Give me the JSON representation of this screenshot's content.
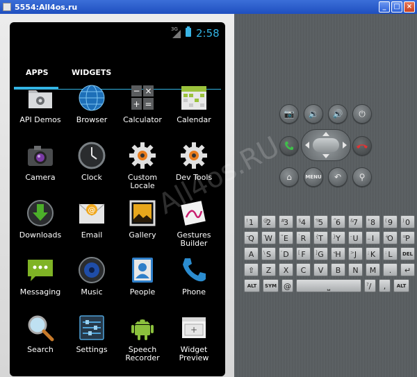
{
  "window": {
    "title": "5554:All4os.ru",
    "minimize": "_",
    "maximize": "□",
    "close": "×"
  },
  "status": {
    "network": "3G",
    "time": "2:58"
  },
  "tabs": [
    {
      "label": "APPS"
    },
    {
      "label": "WIDGETS"
    }
  ],
  "apps": [
    {
      "label": "API Demos",
      "icon": "folder-gear-icon"
    },
    {
      "label": "Browser",
      "icon": "globe-icon"
    },
    {
      "label": "Calculator",
      "icon": "calculator-icon"
    },
    {
      "label": "Calendar",
      "icon": "calendar-icon"
    },
    {
      "label": "Camera",
      "icon": "camera-icon"
    },
    {
      "label": "Clock",
      "icon": "clock-icon"
    },
    {
      "label": "Custom Locale",
      "icon": "gear-icon"
    },
    {
      "label": "Dev Tools",
      "icon": "gear-icon"
    },
    {
      "label": "Downloads",
      "icon": "download-icon"
    },
    {
      "label": "Email",
      "icon": "email-icon"
    },
    {
      "label": "Gallery",
      "icon": "gallery-icon"
    },
    {
      "label": "Gestures Builder",
      "icon": "gestures-icon"
    },
    {
      "label": "Messaging",
      "icon": "messaging-icon"
    },
    {
      "label": "Music",
      "icon": "music-icon"
    },
    {
      "label": "People",
      "icon": "people-icon"
    },
    {
      "label": "Phone",
      "icon": "phone-icon"
    },
    {
      "label": "Search",
      "icon": "search-icon"
    },
    {
      "label": "Settings",
      "icon": "settings-icon"
    },
    {
      "label": "Speech Recorder",
      "icon": "android-icon"
    },
    {
      "label": "Widget Preview",
      "icon": "widget-preview-icon"
    }
  ],
  "controls": {
    "camera": "📷",
    "vol_down": "🔉",
    "vol_up": "🔊",
    "power": "⏻",
    "home": "⌂",
    "menu": "MENU",
    "back": "↶",
    "search": "⚲"
  },
  "keyboard": {
    "row1": [
      {
        "k": "1",
        "a": "!"
      },
      {
        "k": "2",
        "a": "@"
      },
      {
        "k": "3",
        "a": "#"
      },
      {
        "k": "4",
        "a": "$"
      },
      {
        "k": "5",
        "a": "%"
      },
      {
        "k": "6",
        "a": "^"
      },
      {
        "k": "7",
        "a": "&"
      },
      {
        "k": "8",
        "a": "*"
      },
      {
        "k": "9",
        "a": "("
      },
      {
        "k": "0",
        "a": ")"
      }
    ],
    "row2": [
      {
        "k": "Q",
        "a": "~"
      },
      {
        "k": "W",
        "a": "\""
      },
      {
        "k": "E",
        "a": "\""
      },
      {
        "k": "R",
        "a": "`"
      },
      {
        "k": "T",
        "a": "{"
      },
      {
        "k": "Y",
        "a": "}"
      },
      {
        "k": "U",
        "a": "-"
      },
      {
        "k": "I",
        "a": "_"
      },
      {
        "k": "O",
        "a": "+"
      },
      {
        "k": "P",
        "a": "="
      }
    ],
    "row3": [
      {
        "k": "A",
        "a": ""
      },
      {
        "k": "S",
        "a": "\\"
      },
      {
        "k": "D",
        "a": "'"
      },
      {
        "k": "F",
        "a": "["
      },
      {
        "k": "G",
        "a": "]"
      },
      {
        "k": "H",
        "a": "<"
      },
      {
        "k": "J",
        "a": ">"
      },
      {
        "k": "K",
        "a": ";"
      },
      {
        "k": "L",
        "a": ":"
      },
      {
        "k": "DEL",
        "a": ""
      }
    ],
    "row4": [
      {
        "k": "⇧",
        "a": ""
      },
      {
        "k": "Z",
        "a": ""
      },
      {
        "k": "X",
        "a": ""
      },
      {
        "k": "C",
        "a": ""
      },
      {
        "k": "V",
        "a": ""
      },
      {
        "k": "B",
        "a": ""
      },
      {
        "k": "N",
        "a": ""
      },
      {
        "k": "M",
        "a": ""
      },
      {
        "k": ".",
        "a": ""
      },
      {
        "k": "↵",
        "a": ""
      }
    ],
    "row5": [
      {
        "k": "ALT",
        "a": ""
      },
      {
        "k": "SYM",
        "a": ""
      },
      {
        "k": "@",
        "a": ""
      },
      {
        "k": "⎵",
        "a": ""
      },
      {
        "k": "/",
        "a": "?"
      },
      {
        "k": ",",
        "a": ""
      },
      {
        "k": "ALT",
        "a": ""
      }
    ]
  },
  "watermark": "All4os.RU"
}
